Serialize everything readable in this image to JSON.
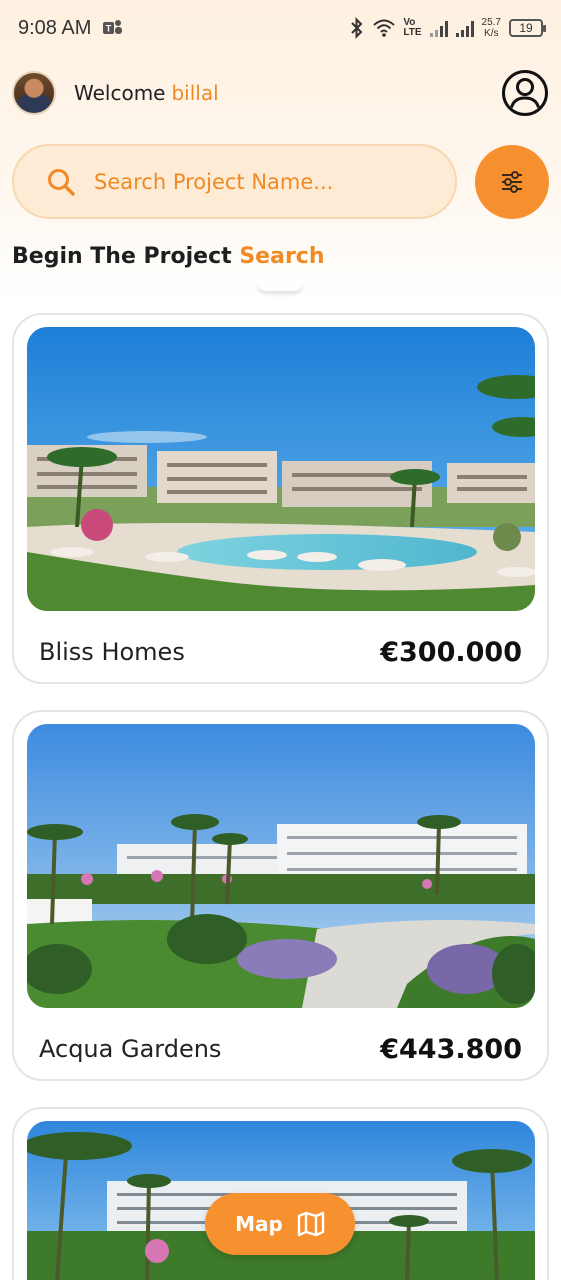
{
  "status_bar": {
    "time": "9:08 AM",
    "teams_icon": "teams-icon",
    "volte_top": "Vo",
    "volte_bottom": "LTE",
    "net_speed_value": "25.7",
    "net_speed_unit": "K/s",
    "battery": "19"
  },
  "header": {
    "welcome_label": "Welcome",
    "user_name": "billal",
    "profile_icon": "user-circle-icon"
  },
  "search": {
    "placeholder": "Search Project Name...",
    "search_icon": "search-icon",
    "filter_icon": "sliders-icon"
  },
  "section": {
    "title_prefix": "Begin The Project",
    "title_accent": "Search"
  },
  "projects": [
    {
      "name": "Bliss Homes",
      "price": "€300.000"
    },
    {
      "name": "Acqua Gardens",
      "price": "€443.800"
    },
    {
      "name": "",
      "price": ""
    }
  ],
  "map_button": {
    "label": "Map",
    "icon": "map-icon"
  },
  "colors": {
    "accent": "#f7902e",
    "accent_text": "#f08a24",
    "search_bg": "#fdebd6"
  }
}
